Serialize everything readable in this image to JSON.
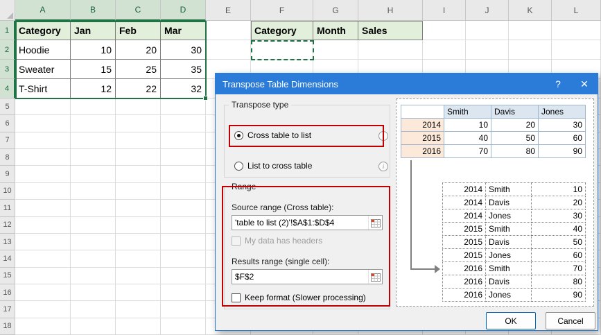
{
  "spreadsheet": {
    "column_headers": [
      "A",
      "B",
      "C",
      "D",
      "E",
      "F",
      "G",
      "H",
      "I",
      "J",
      "K",
      "L"
    ],
    "selected_columns": [
      "A",
      "B",
      "C",
      "D"
    ],
    "row_count": 18,
    "selected_rows": [
      1,
      2,
      3,
      4
    ],
    "selected_range": "A1:D4",
    "active_cell": "F2",
    "cells": {
      "A1": "Category",
      "B1": "Jan",
      "C1": "Feb",
      "D1": "Mar",
      "A2": "Hoodie",
      "B2": "10",
      "C2": "20",
      "D2": "30",
      "A3": "Sweater",
      "B3": "15",
      "C3": "25",
      "D3": "35",
      "A4": "T-Shirt",
      "B4": "12",
      "C4": "22",
      "D4": "32",
      "F1": "Category",
      "G1": "Month",
      "H1": "Sales"
    }
  },
  "dialog": {
    "title": "Transpose Table Dimensions",
    "icons": {
      "help": "?",
      "close": "✕",
      "info": "i"
    },
    "transpose_type": {
      "legend": "Transpose type",
      "options": [
        {
          "label": "Cross table to list",
          "selected": true
        },
        {
          "label": "List to cross table",
          "selected": false
        }
      ]
    },
    "range": {
      "legend": "Range",
      "source_label": "Source range (Cross table):",
      "source_value": "'table to list (2)'!$A$1:$D$4",
      "headers_checkbox_label": "My data has headers",
      "headers_checkbox_checked": false,
      "results_label": "Results range (single cell):",
      "results_value": "$F$2",
      "keep_format_label": "Keep format (Slower processing)",
      "keep_format_checked": false
    },
    "preview": {
      "cross_table": {
        "headers": [
          "",
          "Smith",
          "Davis",
          "Jones"
        ],
        "rows": [
          [
            "2014",
            "10",
            "20",
            "30"
          ],
          [
            "2015",
            "40",
            "50",
            "60"
          ],
          [
            "2016",
            "70",
            "80",
            "90"
          ]
        ]
      },
      "list_table": {
        "rows": [
          [
            "2014",
            "Smith",
            "10"
          ],
          [
            "2014",
            "Davis",
            "20"
          ],
          [
            "2014",
            "Jones",
            "30"
          ],
          [
            "2015",
            "Smith",
            "40"
          ],
          [
            "2015",
            "Davis",
            "50"
          ],
          [
            "2015",
            "Jones",
            "60"
          ],
          [
            "2016",
            "Smith",
            "70"
          ],
          [
            "2016",
            "Davis",
            "80"
          ],
          [
            "2016",
            "Jones",
            "90"
          ]
        ]
      }
    },
    "buttons": {
      "ok": "OK",
      "cancel": "Cancel"
    },
    "colors": {
      "titlebar": "#2b7cd9",
      "highlight": "#c00000",
      "selection": "#217346"
    }
  }
}
